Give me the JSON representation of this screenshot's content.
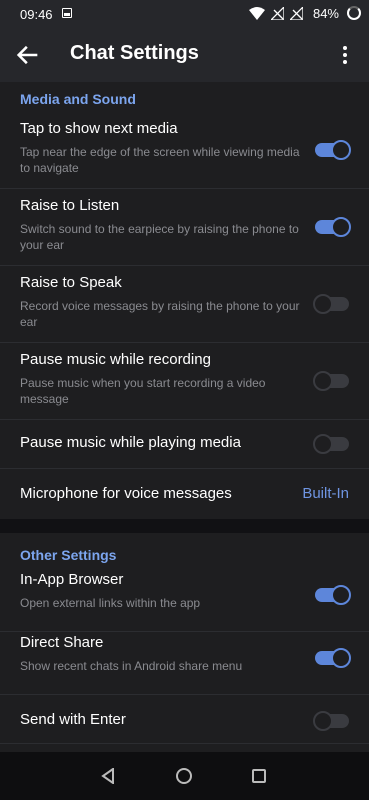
{
  "status": {
    "time": "09:46",
    "battery": "84%"
  },
  "appbar": {
    "title": "Chat Settings"
  },
  "media_section": {
    "header": "Media and Sound",
    "items": [
      {
        "title": "Tap to show next media",
        "subtitle": "Tap near the edge of the screen while viewing media to navigate",
        "on": true
      },
      {
        "title": "Raise to Listen",
        "subtitle": "Switch sound to the earpiece by raising the phone to your ear",
        "on": true
      },
      {
        "title": "Raise to Speak",
        "subtitle": "Record voice messages by raising the phone to your ear",
        "on": false
      },
      {
        "title": "Pause music while recording",
        "subtitle": "Pause music when you start recording a video message",
        "on": false
      },
      {
        "title": "Pause music while playing media",
        "on": false
      }
    ],
    "microphone": {
      "title": "Microphone for voice messages",
      "value": "Built-In"
    }
  },
  "other_section": {
    "header": "Other Settings",
    "items": [
      {
        "title": "In-App Browser",
        "subtitle": "Open external links within the app",
        "on": true
      },
      {
        "title": "Direct Share",
        "subtitle": "Show recent chats in Android share menu",
        "on": true
      },
      {
        "title": "Send with Enter",
        "on": false
      }
    ]
  },
  "colors": {
    "accent": "#5d86da",
    "header": "#7ca5ee",
    "background": "#1e1e20"
  }
}
